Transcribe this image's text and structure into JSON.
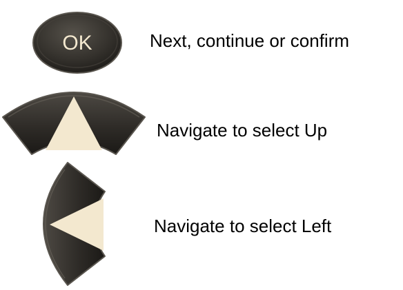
{
  "buttons": [
    {
      "key_label": "OK",
      "description": "Next, continue or confirm",
      "icon": "ok-button-icon"
    },
    {
      "description": "Navigate to select Up",
      "icon": "up-arrow-button-icon"
    },
    {
      "description": "Navigate to select Left",
      "icon": "left-arrow-button-icon"
    }
  ],
  "colors": {
    "button_body": "#2e2b27",
    "button_edge": "#5a564f",
    "arrow_fill": "#f3e8cf",
    "key_text": "#f3e8cf",
    "text": "#000000"
  }
}
